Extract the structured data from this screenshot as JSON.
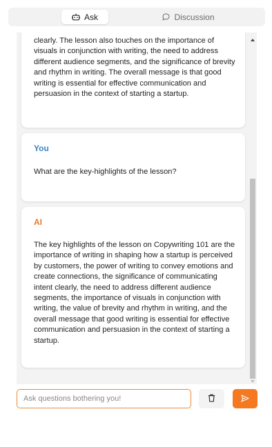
{
  "tabs": {
    "ask": {
      "label": "Ask",
      "icon": "robot-icon"
    },
    "discussion": {
      "label": "Discussion",
      "icon": "chat-bubble-icon"
    }
  },
  "messages": [
    {
      "sender": "",
      "text": "clearly. The lesson also touches on the importance of visuals in conjunction with writing, the need to address different audience segments, and the significance of brevity and rhythm in writing. The overall message is that good writing is essential for effective communication and persuasion in the context of starting a startup."
    },
    {
      "sender": "You",
      "text": "What are the key-highlights of the lesson?"
    },
    {
      "sender": "AI",
      "text": "The key highlights of the lesson on Copywriting 101 are the importance of writing in shaping how a startup is perceived by customers, the power of writing to convey emotions and create connections, the significance of communicating intent clearly, the need to address different audience segments, the importance of visuals in conjunction with writing, the value of brevity and rhythm in writing, and the overall message that good writing is essential for effective communication and persuasion in the context of starting a startup."
    }
  ],
  "input": {
    "placeholder": "Ask questions bothering you!",
    "value": ""
  },
  "buttons": {
    "clear_icon": "trash-icon",
    "send_icon": "send-icon"
  },
  "colors": {
    "accent": "#f47921",
    "you_label": "#3b82c4",
    "ai_label": "#e67a2e",
    "panel_bg": "#f3f3f4"
  }
}
